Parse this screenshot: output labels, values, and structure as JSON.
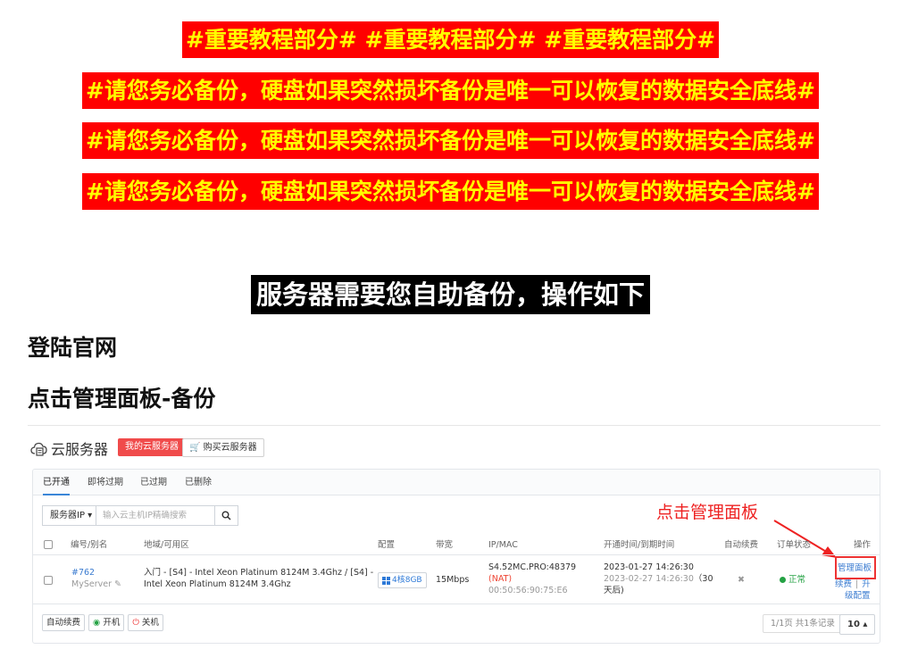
{
  "banners": {
    "important": "#重要教程部分#  #重要教程部分#  #重要教程部分#",
    "warning_1": "#请您务必备份，硬盘如果突然损坏备份是唯一可以恢复的数据安全底线#",
    "warning_2": "#请您务必备份，硬盘如果突然损坏备份是唯一可以恢复的数据安全底线#",
    "warning_3": "#请您务必备份，硬盘如果突然损坏备份是唯一可以恢复的数据安全底线#",
    "self_backup": "服务器需要您自助备份，操作如下"
  },
  "steps": {
    "step1": "登陆官网",
    "step2": "点击管理面板-备份"
  },
  "colors": {
    "banner_bg": "#ff0000",
    "banner_text": "#ffff00",
    "accent_blue": "#3a86d8",
    "my_server_btn": "#f04b4b",
    "annotation_red": "#ee2222",
    "status_green": "#25a244"
  },
  "panel": {
    "title": "云服务器",
    "title_icon": "cloud-server-icon",
    "my_servers_button": "我的云服务器",
    "buy_button": "购买云服务器",
    "buy_icon": "cart-icon",
    "tabs": [
      "已开通",
      "即将过期",
      "已过期",
      "已删除"
    ],
    "active_tab": "已开通",
    "search": {
      "filter_label": "服务器IP",
      "placeholder": "输入云主机IP精确搜索",
      "button_icon": "search-icon"
    },
    "annotation": "点击管理面板",
    "columns": [
      "编号/别名",
      "地域/可用区",
      "配置",
      "带宽",
      "IP/MAC",
      "开通时间/到期时间",
      "自动续费",
      "订单状态",
      "操作"
    ],
    "row": {
      "id": "#762",
      "alias": "MyServer",
      "region_line1": "入门 - [S4] - Intel Xeon Platinum 8124M 3.4Ghz / [S4] -",
      "region_line2": "Intel Xeon Platinum 8124M 3.4Ghz",
      "config": "4核8GB",
      "bandwidth": "15Mbps",
      "ip": "S4.52MC.PRO:48379",
      "nat": "(NAT)",
      "mac": "00:50:56:90:75:E6",
      "open_time": "2023-01-27 14:26:30",
      "expire_time": "2023-02-27 14:26:30",
      "days_left": "（30",
      "days_left_2": "天后)",
      "auto_renew": "✖",
      "status": "正常",
      "action_manage": "管理面板",
      "action_renew": "续费",
      "action_sep": "|",
      "action_upgrade_1": "升",
      "action_upgrade_2": "级配置"
    },
    "footer": {
      "auto_renew": "自动续费",
      "power_on": "开机",
      "power_off": "关机",
      "page_info": "1/1页 共1条记录",
      "page_size": "10"
    }
  }
}
